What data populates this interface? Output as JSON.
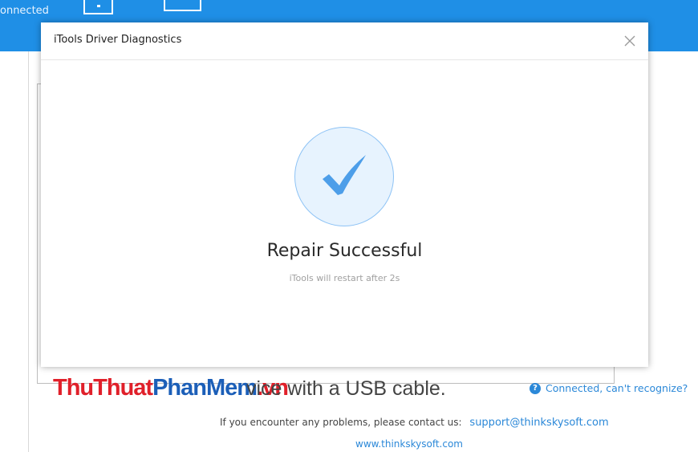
{
  "app": {
    "status_text": "onnected",
    "connect_prompt": "vice with a USB cable.",
    "help_link": "Connected, can't recognize?",
    "contact_text": "If you encounter any problems, please contact us:",
    "support_email": "support@thinkskysoft.com",
    "website": "www.thinkskysoft.com",
    "accent_color": "#1f8fe6"
  },
  "watermark": {
    "part1": "ThuThuat",
    "part2": "PhanMem",
    "part3": ".vn"
  },
  "dialog": {
    "title": "iTools Driver Diagnostics",
    "result_title": "Repair Successful",
    "result_subtitle": "iTools will restart after 2s",
    "icons": [
      "close-icon",
      "checkmark-icon"
    ]
  }
}
